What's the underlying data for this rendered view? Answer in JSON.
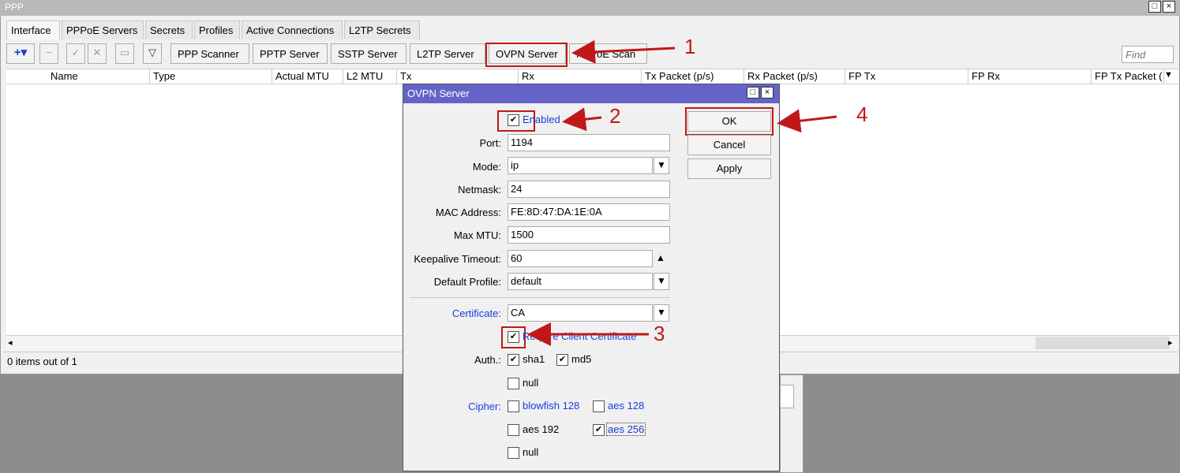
{
  "window": {
    "title": "PPP"
  },
  "tabs": [
    "Interface",
    "PPPoE Servers",
    "Secrets",
    "Profiles",
    "Active Connections",
    "L2TP Secrets"
  ],
  "toolbar": {
    "buttons": [
      "PPP Scanner",
      "PPTP Server",
      "SSTP Server",
      "L2TP Server",
      "OVPN Server",
      "PPPoE Scan"
    ],
    "find_placeholder": "Find"
  },
  "table": {
    "columns": [
      "Name",
      "Type",
      "Actual MTU",
      "L2 MTU",
      "Tx",
      "Rx",
      "Tx Packet (p/s)",
      "Rx Packet (p/s)",
      "FP Tx",
      "FP Rx",
      "FP Tx Packet ("
    ]
  },
  "status": "0 items out of 1",
  "dialog": {
    "title": "OVPN Server",
    "enabled_label": "Enabled",
    "port_label": "Port:",
    "port": "1194",
    "mode_label": "Mode:",
    "mode": "ip",
    "netmask_label": "Netmask:",
    "netmask": "24",
    "mac_label": "MAC Address:",
    "mac": "FE:8D:47:DA:1E:0A",
    "maxmtu_label": "Max MTU:",
    "maxmtu": "1500",
    "keepalive_label": "Keepalive Timeout:",
    "keepalive": "60",
    "profile_label": "Default Profile:",
    "profile": "default",
    "cert_label": "Certificate:",
    "cert": "CA",
    "require_label": "Require Client Certificate",
    "auth_label": "Auth.:",
    "auth_sha1": "sha1",
    "auth_md5": "md5",
    "auth_null": "null",
    "cipher_label": "Cipher:",
    "cipher_blowfish": "blowfish 128",
    "cipher_aes128": "aes 128",
    "cipher_aes192": "aes 192",
    "cipher_aes256": "aes 256",
    "cipher_null": "null",
    "ok": "OK",
    "cancel": "Cancel",
    "apply": "Apply"
  },
  "annotations": [
    "1",
    "2",
    "3",
    "4"
  ]
}
